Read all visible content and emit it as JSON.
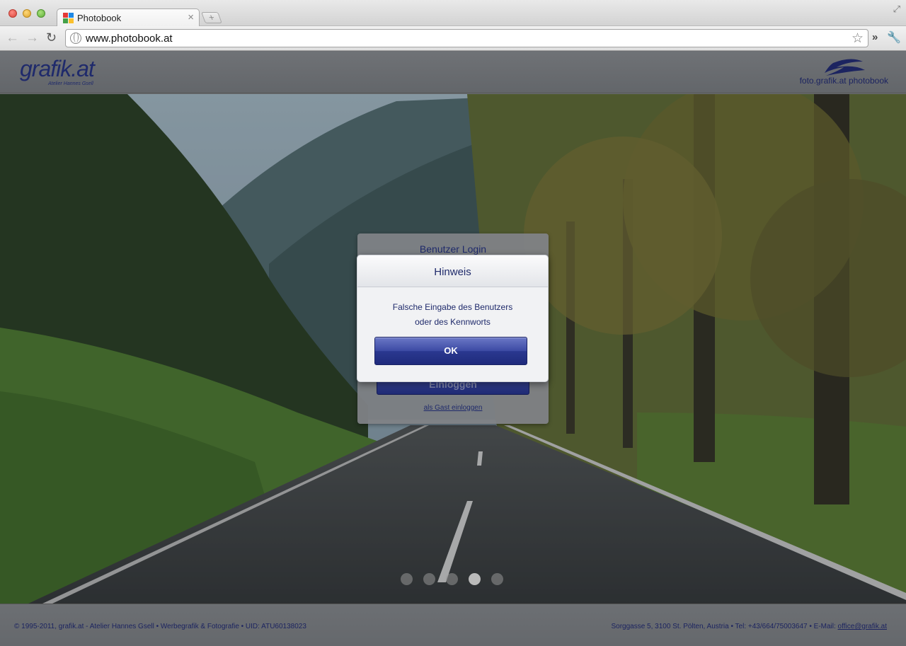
{
  "browser": {
    "tab_title": "Photobook",
    "url": "www.photobook.at",
    "new_tab_symbol": "+",
    "tab_close_symbol": "×"
  },
  "header": {
    "logo_main": "grafik.at",
    "logo_sub": "Atelier Hannes Gsell",
    "brand_right": "foto.grafik.at photobook"
  },
  "login": {
    "title": "Benutzer Login",
    "submit_label": "Einloggen",
    "guest_link": "als Gast einloggen"
  },
  "dialog": {
    "title": "Hinweis",
    "message_line1": "Falsche Eingabe des Benutzers",
    "message_line2": "oder des Kennworts",
    "ok_label": "OK"
  },
  "slideshow": {
    "dot_count": 5,
    "active_index": 3
  },
  "footer": {
    "left": "© 1995-2011, grafik.at - Atelier Hannes Gsell • Werbegrafik & Fotografie • UID: ATU60138023",
    "right_text": "Sorggasse 5, 3100 St. Pölten, Austria • Tel: +43/664/75003647 • E-Mail: ",
    "email": "office@grafik.at"
  },
  "colors": {
    "brand_navy": "#1f2a6b",
    "ok_button": "#2a3890"
  }
}
